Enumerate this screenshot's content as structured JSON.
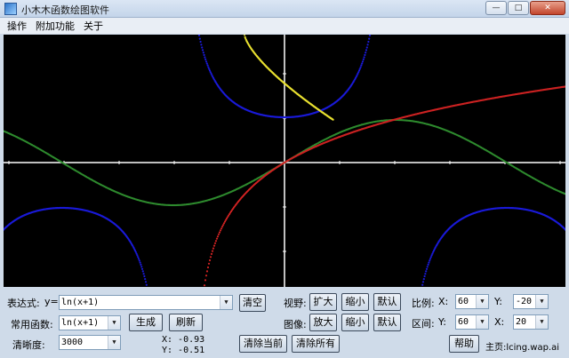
{
  "window": {
    "title": "小木木函数绘图软件",
    "controls": {
      "minimize": "—",
      "maximize": "□",
      "close": "✕"
    }
  },
  "menu": [
    "操作",
    "附加功能",
    "关于"
  ],
  "plot": {
    "background": "#000000",
    "axis_color": "#ffffff",
    "curves": [
      {
        "color": "#1a1ad8",
        "desc": "tan-like blue"
      },
      {
        "color": "#2e8b2e",
        "desc": "sine green"
      },
      {
        "color": "#cc2222",
        "desc": "ln(x+1) red"
      },
      {
        "color": "#e8e030",
        "desc": "yellow"
      }
    ]
  },
  "controls": {
    "expression_label": "表达式:",
    "y_prefix": "y=",
    "expression_value": "ln(x+1)",
    "clear_button": "清空",
    "common_functions_label": "常用函数:",
    "common_functions_value": "ln(x+1)",
    "generate_button": "生成",
    "refresh_button": "刷新",
    "clarity_label": "清晰度:",
    "clarity_value": "3000",
    "cursor_x": "X: -0.93",
    "cursor_y": "Y: -0.51",
    "view_label": "视野:",
    "view_zoom_in": "扩大",
    "view_zoom_out": "缩小",
    "view_default": "默认",
    "image_label": "图像:",
    "image_zoom_in": "放大",
    "image_zoom_out": "缩小",
    "image_default": "默认",
    "clear_current_button": "清除当前",
    "clear_all_button": "清除所有",
    "scale_label": "比例:",
    "scale_x_label": "X:",
    "scale_x_value": "60",
    "scale_y_label": "Y:",
    "scale_y_value": "-20",
    "range_label": "区间:",
    "range_y_label": "Y:",
    "range_y_value": "60",
    "range_x_label": "X:",
    "range_x_value": "20",
    "help_button": "帮助",
    "homepage": "主页:lcing.wap.ai"
  }
}
